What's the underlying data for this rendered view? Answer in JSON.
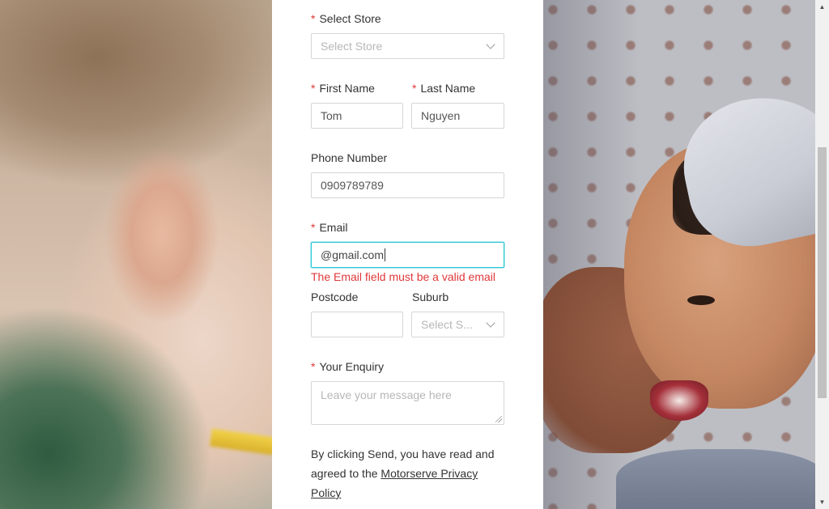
{
  "form": {
    "store": {
      "required": "*",
      "label": "Select Store",
      "placeholder": "Select Store"
    },
    "first_name": {
      "required": "*",
      "label": "First Name",
      "value": "Tom"
    },
    "last_name": {
      "required": "*",
      "label": "Last Name",
      "value": "Nguyen"
    },
    "phone": {
      "label": "Phone Number",
      "value": "0909789789"
    },
    "email": {
      "required": "*",
      "label": "Email",
      "value": "@gmail.com",
      "error": "The Email field must be a valid email"
    },
    "postcode": {
      "label": "Postcode",
      "value": ""
    },
    "suburb": {
      "label": "Suburb",
      "placeholder": "Select S..."
    },
    "enquiry": {
      "required": "*",
      "label": "Your Enquiry",
      "placeholder": "Leave your message here"
    },
    "consent": {
      "prefix": "By clicking Send, you have read and agreed to the ",
      "link": "Motorserve Privacy Policy"
    }
  },
  "colors": {
    "required_mark": "#e0383a",
    "error_text": "#e0383a",
    "focus_border": "#28c6d6",
    "panel_bg": "#ffffff"
  },
  "icons": {
    "dropdown": "chevron-down-icon",
    "scroll_up": "arrow-up-icon",
    "scroll_down": "arrow-down-icon",
    "resize": "resize-grip-icon"
  }
}
